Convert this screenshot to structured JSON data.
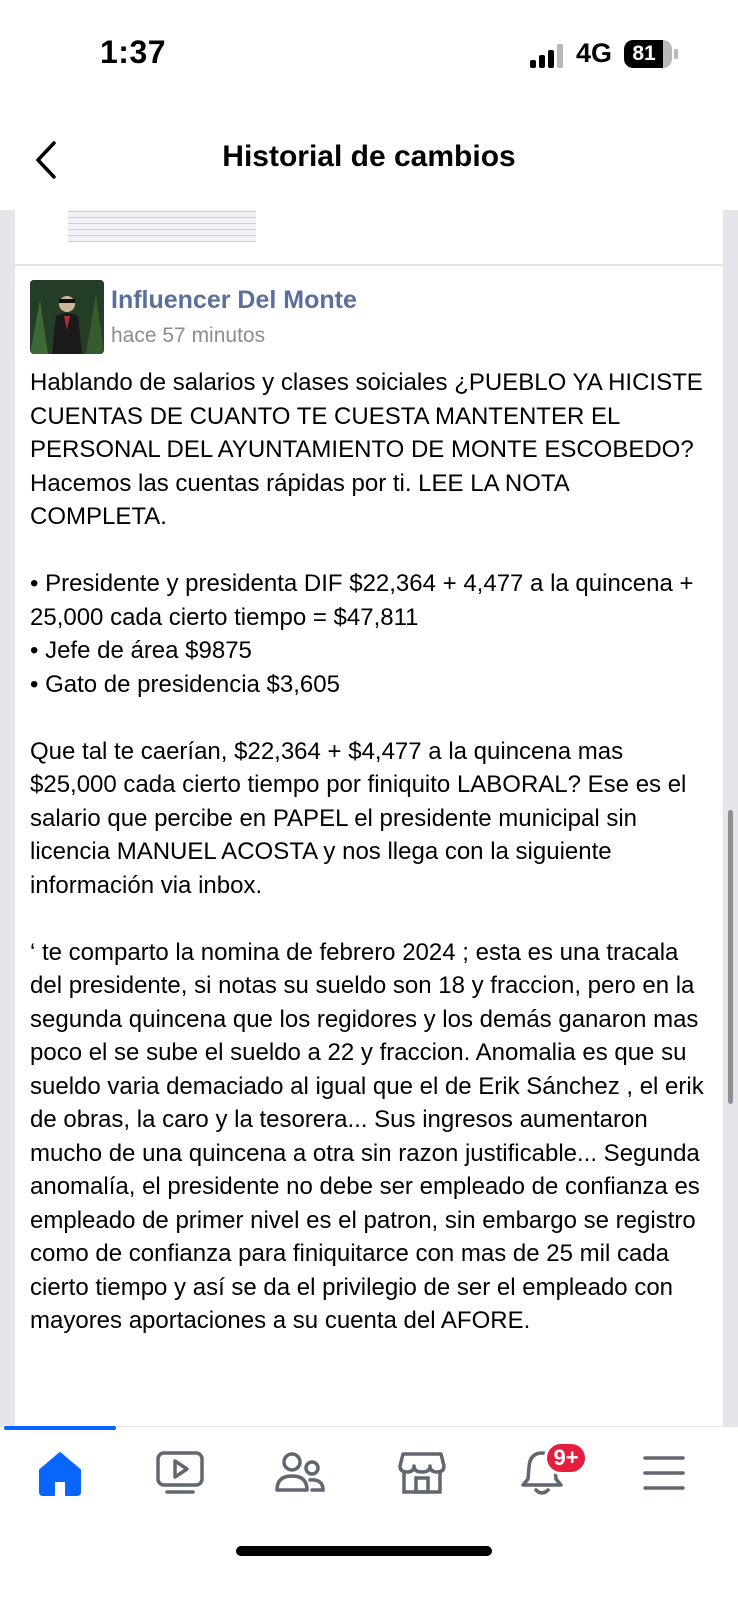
{
  "status_bar": {
    "time": "1:37",
    "network": "4G",
    "battery": "81",
    "battery_level": 0.81
  },
  "header": {
    "title": "Historial de cambios"
  },
  "post": {
    "author": "Influencer Del Monte",
    "time_ago": "hace 57 minutos",
    "paragraphs": [
      "Hablando de salarios y clases soiciales ¿PUEBLO YA HICISTE CUENTAS DE CUANTO TE CUESTA MANTENTER EL PERSONAL DEL AYUNTAMIENTO DE MONTE ESCOBEDO? Hacemos las cuentas rápidas por ti. LEE LA NOTA COMPLETA.",
      "• Presidente y presidenta DIF $22,364 + 4,477 a la quincena + 25,000 cada cierto tiempo = $47,811",
      "• Jefe de área $9875",
      "• Gato de presidencia $3,605",
      "Que tal te caerían, $22,364 + $4,477 a la quincena mas $25,000 cada cierto tiempo por finiquito LABORAL? Ese es el salario que percibe en PAPEL el presidente municipal sin licencia MANUEL ACOSTA y nos llega con la siguiente información via inbox.",
      "‘ te comparto la nomina de febrero 2024 ; esta es una tracala del presidente, si notas su sueldo son 18 y fraccion, pero en la segunda quincena que los regidores y los demás ganaron mas poco el se sube el sueldo a 22 y fraccion. Anomalia es que su sueldo varia demaciado al igual que el de Erik Sánchez , el erik de obras, la caro y la tesorera... Sus ingresos aumentaron mucho de una quincena a otra sin razon justificable... Segunda anomalía, el presidente no debe ser empleado de confianza es empleado de primer nivel es el patron, sin embargo se registro como de confianza para finiquitarce con mas de 25 mil cada cierto tiempo y así se da el privilegio de ser el empleado con mayores aportaciones a su cuenta del AFORE."
    ]
  },
  "tab_bar": {
    "tabs": [
      {
        "name": "home",
        "icon": "home-icon",
        "active": true
      },
      {
        "name": "video",
        "icon": "video-icon",
        "active": false
      },
      {
        "name": "friends",
        "icon": "friends-icon",
        "active": false
      },
      {
        "name": "marketplace",
        "icon": "marketplace-icon",
        "active": false
      },
      {
        "name": "notifications",
        "icon": "bell-icon",
        "active": false
      },
      {
        "name": "menu",
        "icon": "menu-icon",
        "active": false
      }
    ],
    "notification_badge": "9+"
  },
  "colors": {
    "accent": "#0866ff",
    "author": "#5b6f9b",
    "badge": "#e41e3f",
    "feed_bg": "#e4e6eb"
  }
}
